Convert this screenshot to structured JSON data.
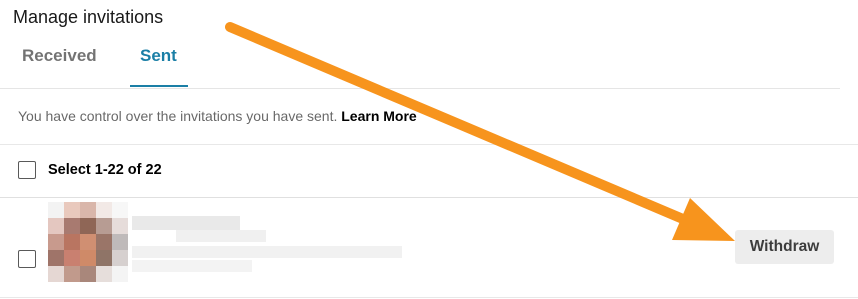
{
  "header": {
    "title": "Manage invitations"
  },
  "tabs": [
    {
      "label": "Received",
      "active": false
    },
    {
      "label": "Sent",
      "active": true
    }
  ],
  "info": {
    "text": "You have control over the invitations you have sent.",
    "link_label": "Learn More"
  },
  "selection": {
    "label": "Select 1-22 of 22"
  },
  "invitations": [
    {
      "name": "",
      "action_label": "Withdraw"
    }
  ],
  "colors": {
    "accent": "#1b7fa6",
    "annotation_arrow": "#f7941d",
    "button_bg": "#ededed"
  }
}
